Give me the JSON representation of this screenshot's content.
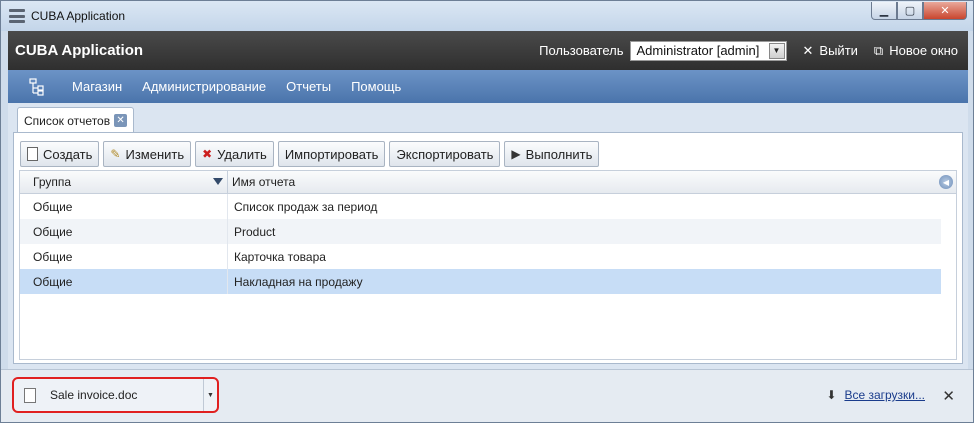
{
  "window": {
    "title": "CUBA Application",
    "min_glyph": "▁",
    "max_glyph": "▢",
    "close_glyph": "✕"
  },
  "header": {
    "app_title": "CUBA Application",
    "user_label": "Пользователь",
    "user_value": "Administrator [admin]",
    "logout_label": "Выйти",
    "logout_glyph": "✕",
    "new_window_label": "Новое окно",
    "new_window_glyph": "⧉"
  },
  "menu": {
    "items": [
      "Магазин",
      "Администрирование",
      "Отчеты",
      "Помощь"
    ]
  },
  "tab": {
    "label": "Список отчетов",
    "close_glyph": "✕"
  },
  "toolbar": {
    "create": "Создать",
    "edit": "Изменить",
    "delete": "Удалить",
    "import": "Импортировать",
    "export": "Экспортировать",
    "run": "Выполнить"
  },
  "grid": {
    "columns": [
      "Группа",
      "Имя отчета"
    ],
    "rows": [
      {
        "group": "Общие",
        "name": "Список продаж за период"
      },
      {
        "group": "Общие",
        "name": "Product"
      },
      {
        "group": "Общие",
        "name": "Карточка товара"
      },
      {
        "group": "Общие",
        "name": "Накладная на продажу"
      }
    ]
  },
  "downloads": {
    "file_name": "Sale invoice.doc",
    "all_label": "Все загрузки...",
    "close_glyph": "✕"
  },
  "colors": {
    "header_bg": "#2f2f2f",
    "menu_bg": "#4a74ab",
    "selected_row": "#c7ddf6",
    "highlight_border": "#e02020"
  }
}
